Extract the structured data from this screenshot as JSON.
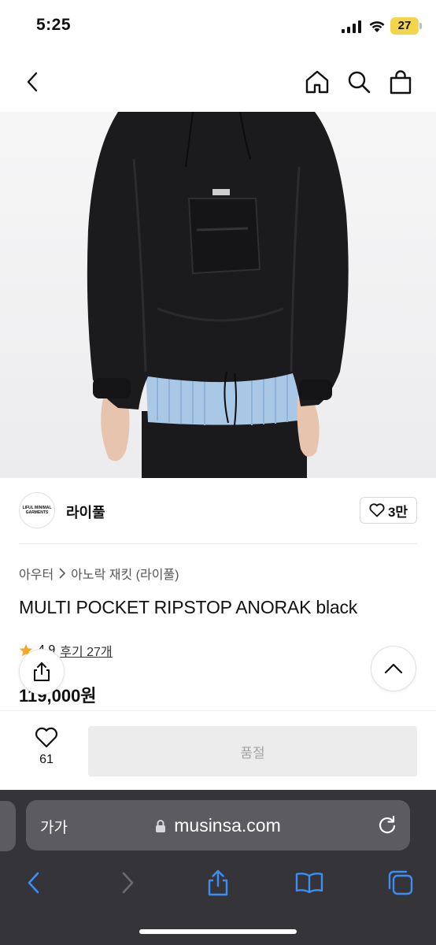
{
  "status_bar": {
    "time": "5:25",
    "battery": "27"
  },
  "nav": {
    "back_icon": "chevron-left-icon",
    "home_icon": "home-icon",
    "search_icon": "search-icon",
    "cart_icon": "shopping-bag-icon"
  },
  "product": {
    "image_alt": "black anorak jacket worn by model",
    "brand_logo_text": [
      "LIFUL MINIMAL",
      "GARMENTS"
    ],
    "brand_name": "라이풀",
    "brand_likes": "3만",
    "breadcrumb": [
      "아우터",
      "아노락 재킷 (라이풀)"
    ],
    "title": "MULTI POCKET RIPSTOP ANORAK black",
    "rating": "4.9",
    "reviews": "후기 27개",
    "price": "119,000원"
  },
  "purchase_bar": {
    "wish_count": "61",
    "soldout_label": "품절"
  },
  "browser": {
    "text_size_label": "가가",
    "url": "musinsa.com"
  },
  "colors": {
    "safari_bg": "#353539",
    "url_field_bg": "#5b5b60",
    "ios_blue": "#3a8ef6",
    "star": "#f5a623",
    "battery": "#f2d54a"
  }
}
